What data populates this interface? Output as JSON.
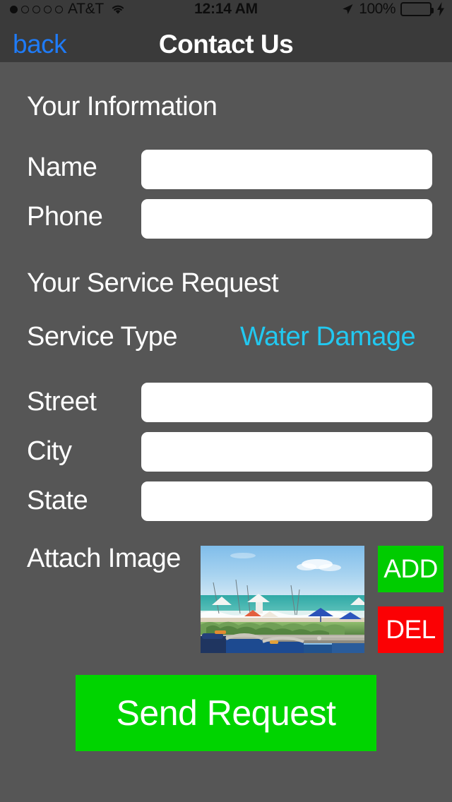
{
  "status_bar": {
    "signal_dots_total": 5,
    "signal_dots_filled": 1,
    "carrier": "AT&T",
    "wifi_icon": "wifi-icon",
    "time": "12:14 AM",
    "location_icon": "location-arrow-icon",
    "battery_percent": "100%",
    "battery_level": 100,
    "battery_color": "#4cd964",
    "charging_icon": "lightning-bolt-icon"
  },
  "navbar": {
    "back_label": "back",
    "back_color": "#1f7bf7",
    "title": "Contact Us"
  },
  "form": {
    "section_information": "Your Information",
    "section_request": "Your Service Request",
    "fields": {
      "name_label": "Name",
      "name_value": "",
      "name_placeholder": "",
      "phone_label": "Phone",
      "phone_value": "",
      "phone_placeholder": "",
      "street_label": "Street",
      "street_value": "",
      "street_placeholder": "",
      "city_label": "City",
      "city_value": "",
      "city_placeholder": "",
      "state_label": "State",
      "state_value": "",
      "state_placeholder": ""
    },
    "service_type": {
      "label": "Service Type",
      "value": "Water Damage",
      "value_color": "#22c8f0"
    },
    "attach": {
      "label": "Attach Image",
      "thumbnail_name": "beach-photo-thumbnail",
      "add_label": "ADD",
      "add_color": "#00cc00",
      "del_label": "DEL",
      "del_color": "#fb0104"
    },
    "submit_label": "Send Request",
    "submit_color": "#00d400"
  },
  "theme": {
    "background": "#565656",
    "navbar_background": "#3a3a3a",
    "field_background": "#ffffff",
    "text_color": "#ffffff"
  }
}
